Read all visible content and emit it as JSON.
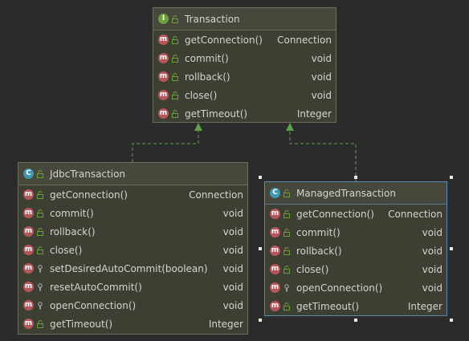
{
  "classes": [
    {
      "id": "transaction",
      "kind_letter": "I",
      "name": "Transaction",
      "methods": [
        {
          "name": "getConnection()",
          "type": "Connection",
          "visibility": "public"
        },
        {
          "name": "commit()",
          "type": "void",
          "visibility": "public"
        },
        {
          "name": "rollback()",
          "type": "void",
          "visibility": "public"
        },
        {
          "name": "close()",
          "type": "void",
          "visibility": "public"
        },
        {
          "name": "getTimeout()",
          "type": "Integer",
          "visibility": "public"
        }
      ]
    },
    {
      "id": "jdbc",
      "kind_letter": "C",
      "name": "JdbcTransaction",
      "methods": [
        {
          "name": "getConnection()",
          "type": "Connection",
          "visibility": "public"
        },
        {
          "name": "commit()",
          "type": "void",
          "visibility": "public"
        },
        {
          "name": "rollback()",
          "type": "void",
          "visibility": "public"
        },
        {
          "name": "close()",
          "type": "void",
          "visibility": "public"
        },
        {
          "name": "setDesiredAutoCommit(boolean)",
          "type": "void",
          "visibility": "protected"
        },
        {
          "name": "resetAutoCommit()",
          "type": "void",
          "visibility": "protected"
        },
        {
          "name": "openConnection()",
          "type": "void",
          "visibility": "protected"
        },
        {
          "name": "getTimeout()",
          "type": "Integer",
          "visibility": "public"
        }
      ]
    },
    {
      "id": "managed",
      "kind_letter": "C",
      "name": "ManagedTransaction",
      "selected": true,
      "methods": [
        {
          "name": "getConnection()",
          "type": "Connection",
          "visibility": "public"
        },
        {
          "name": "commit()",
          "type": "void",
          "visibility": "public"
        },
        {
          "name": "rollback()",
          "type": "void",
          "visibility": "public"
        },
        {
          "name": "close()",
          "type": "void",
          "visibility": "public"
        },
        {
          "name": "openConnection()",
          "type": "void",
          "visibility": "protected"
        },
        {
          "name": "getTimeout()",
          "type": "Integer",
          "visibility": "public"
        }
      ]
    }
  ],
  "relations": [
    {
      "kind": "implements",
      "from": "jdbc",
      "to": "transaction"
    },
    {
      "kind": "implements",
      "from": "managed",
      "to": "transaction"
    }
  ],
  "colors": {
    "background": "#2b2b2b",
    "box": "#3c3f32",
    "method_badge": "#b5575a",
    "class_badge": "#3f97b1",
    "interface_badge": "#6a9f3a",
    "relation_line": "#5ea14f",
    "selection": "#5c88b8"
  }
}
